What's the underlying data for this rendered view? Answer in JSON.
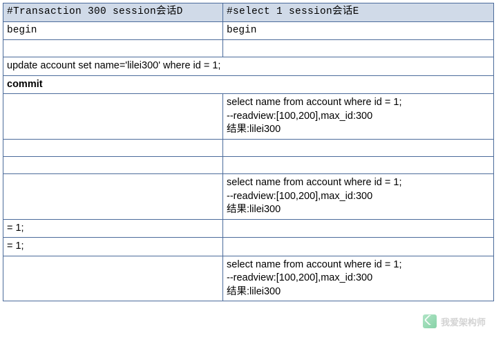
{
  "headers": {
    "col_d": "#Transaction 300  session会话D",
    "col_e": "#select 1  session会话E"
  },
  "rows": {
    "r1": {
      "d": "begin",
      "e": "begin"
    },
    "r3_span": "update account set name='lilei300' where id = 1;",
    "r4_span": "commit",
    "r5_e": "select name from account where id = 1;\n--readview:[100,200],max_id:300\n结果:lilei300",
    "r8_e": "select name from account where id = 1;\n--readview:[100,200],max_id:300\n结果:lilei300",
    "r9_d": "= 1;",
    "r10_d": "= 1;",
    "r11_e": "select name from account where id = 1;\n--readview:[100,200],max_id:300\n结果:lilei300"
  },
  "watermark": "我爱架构师"
}
